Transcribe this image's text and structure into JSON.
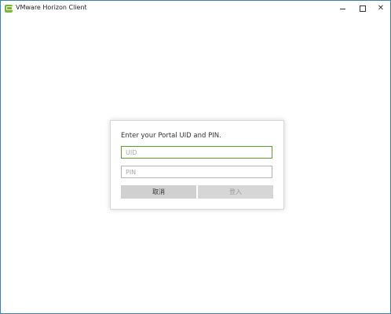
{
  "window": {
    "title": "VMware Horizon Client",
    "controls": {
      "minimize_glyph": "–",
      "maximize_glyph": "",
      "close_glyph": "✕"
    }
  },
  "login": {
    "prompt": "Enter your Portal UID and PIN.",
    "uid_placeholder": "UID",
    "pin_placeholder": "PIN",
    "cancel_label": "取消",
    "login_label": "登入"
  },
  "colors": {
    "focus_border": "#5e9c2a",
    "app_icon": "#78b82a",
    "button_bg": "#d0d0d0"
  }
}
